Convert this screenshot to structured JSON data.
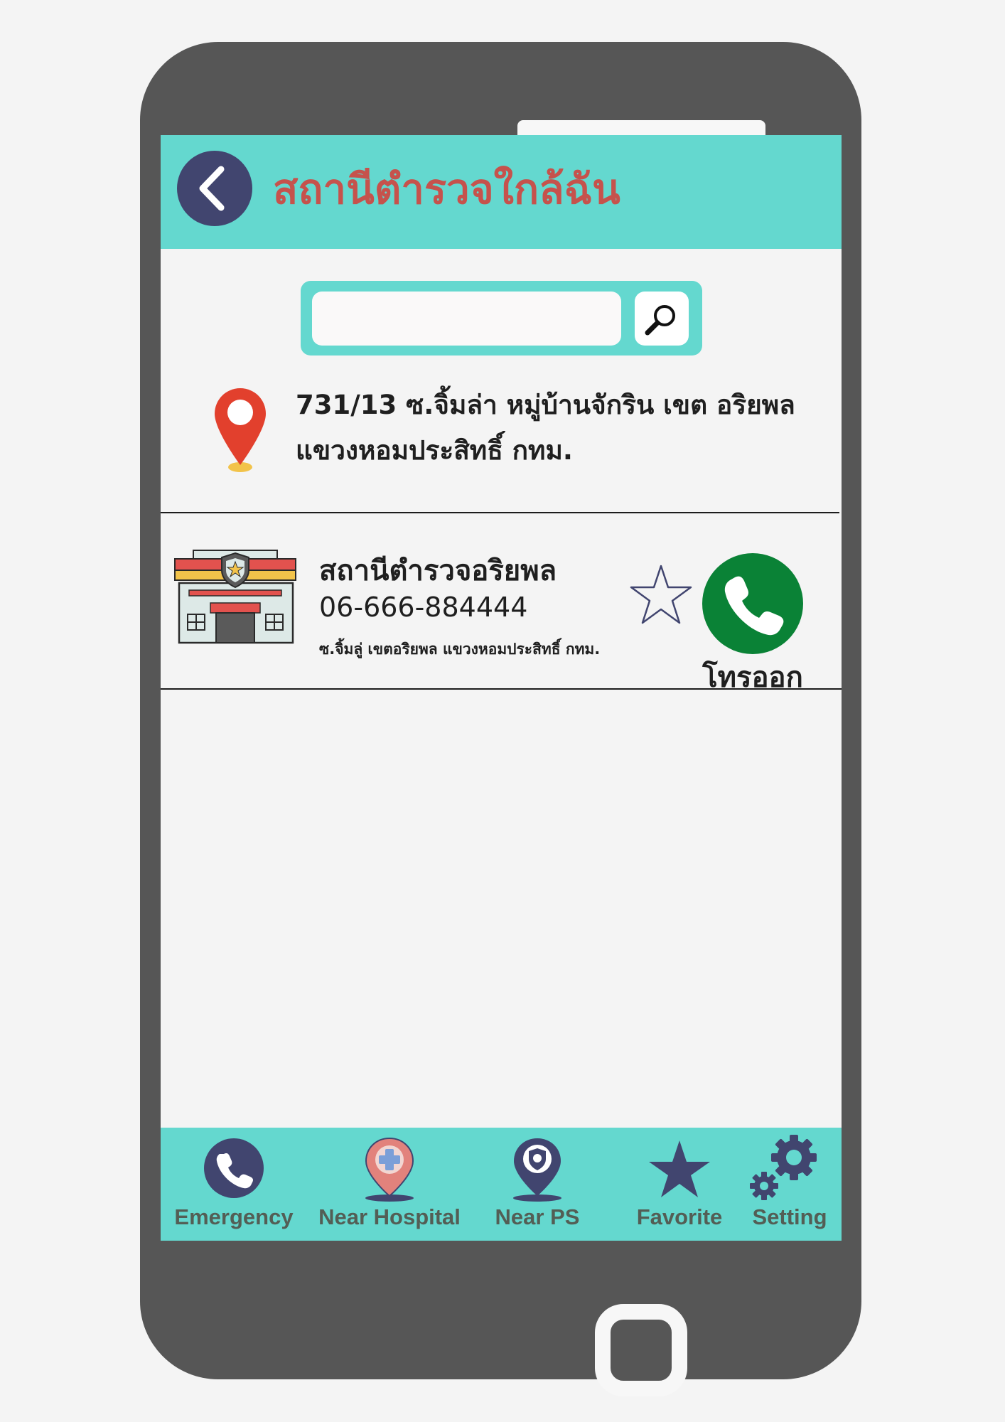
{
  "header": {
    "title": "สถานีตำรวจใกล้ฉัน"
  },
  "search": {
    "value": "",
    "placeholder": ""
  },
  "location": {
    "address": "731/13 ซ.จิ้มล่า หมู่บ้านจักริน เขต อริยพล แขวงหอมประสิทธิ์ กทม."
  },
  "station": {
    "name": "สถานีตำรวจอริยพล",
    "phone": "06-666-884444",
    "address": "ซ.จิ้มลู่ เขตอริยพล แขวงหอมประสิทธิ์ กทม.",
    "call_label": "โทรออก",
    "favorite": false
  },
  "nav": {
    "items": [
      {
        "label": "Emergency",
        "icon": "phone-icon"
      },
      {
        "label": "Near Hospital",
        "icon": "hospital-pin-icon"
      },
      {
        "label": "Near PS",
        "icon": "police-pin-icon"
      },
      {
        "label": "Favorite",
        "icon": "star-icon"
      },
      {
        "label": "Setting",
        "icon": "gears-icon"
      }
    ]
  },
  "colors": {
    "accent": "#64d8cf",
    "title": "#c6524c",
    "navy": "#41456f",
    "call": "#0a8236",
    "phone_body": "#565656"
  }
}
